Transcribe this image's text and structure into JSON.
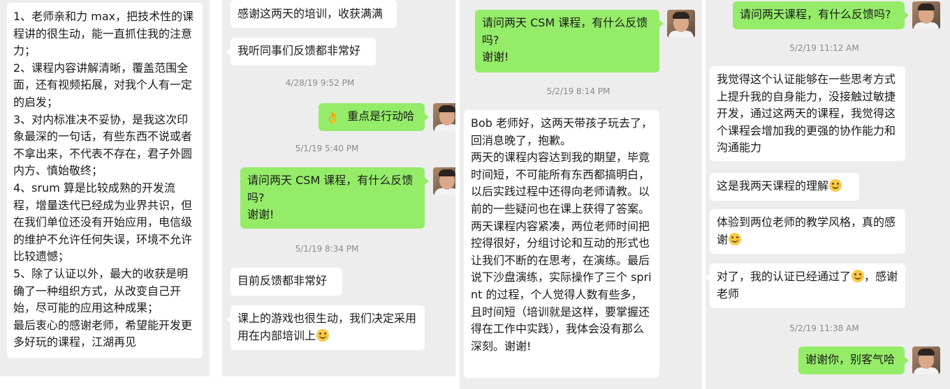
{
  "panel1": {
    "message": "1、老师亲和力 max，把技术性的课程讲的很生动，能一直抓住我的注意力；\n2、课程内容讲解清晰，覆盖范围全面，还有视频拓展，对我个人有一定的启发；\n3、对内标准决不妥协，是我这次印象最深的一句话，有些东西不说或者不拿出来，不代表不存在，君子外圆内方、慎始敬终；\n4、srum 算是比较成熟的开发流程，增量迭代已经成为业界共识，但在我们单位还没有开始应用，电信级的维护不允许任何失误，环境不允许比较遗憾；\n5、除了认证以外，最大的收获是明确了一种组织方式，从改变自己开始，尽可能的应用这种成果；\n最后衷心的感谢老师，希望能开发更多好玩的课程，江湖再见"
  },
  "panel2": {
    "msg1": "感谢这两天的培训，收获满满",
    "msg2": "我听同事们反馈都非常好",
    "ts1": "4/28/19 9:52 PM",
    "msg3": "重点是行动哈",
    "ts2": "5/1/19 5:40 PM",
    "msg4": "请问两天 CSM 课程，有什么反馈吗?\n谢谢!",
    "ts3": "5/1/19 8:34 PM",
    "msg5": "目前反馈都非常好",
    "msg6": "课上的游戏也很生动，我们决定采用用在内部培训上"
  },
  "panel3": {
    "msg1": "请问两天 CSM 课程，有什么反馈吗?\n谢谢!",
    "ts1": "5/2/19 8:14 PM",
    "msg2": "Bob 老师好，这两天带孩子玩去了，回消息晚了，抱歉。\n两天的课程内容达到我的期望，毕竟时间短，不可能所有东西都搞明白，以后实践过程中还得向老师请教。以前的一些疑问也在课上获得了答案。\n两天课程内容紧凑，两位老师时间把控得很好，分组讨论和互动的形式也让我们不断的在思考，在演练。最后说下沙盘演练，实际操作了三个 sprint 的过程，个人觉得人数有些多，且时间短（培训就是这样，要掌握还得在工作中实践），我体会没有那么深刻。谢谢!"
  },
  "panel4": {
    "msg1": "请问两天课程，有什么反馈吗?",
    "ts1": "5/2/19 11:12 AM",
    "msg2": "我觉得这个认证能够在一些思考方式上提升我的自身能力，没接触过敏捷开发，通过这两天的课程，我觉得这个课程会增加我的更强的协作能力和沟通能力",
    "msg3": "这是我两天课程的理解",
    "msg4": "体验到两位老师的教学风格，真的感谢",
    "msg5a": "对了，我的认证已经通过了",
    "msg5b": "，感谢老师",
    "ts2": "5/2/19 11:38 AM",
    "msg6": "谢谢你，别客气哈"
  }
}
